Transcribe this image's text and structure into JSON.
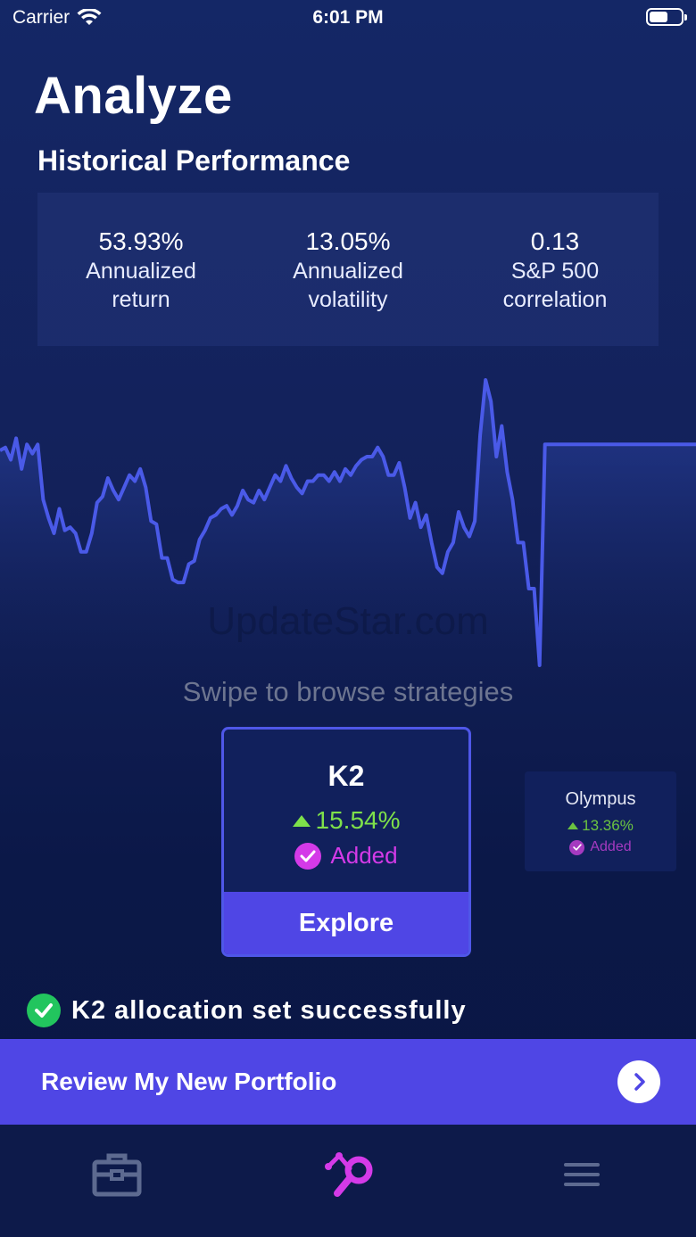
{
  "status_bar": {
    "carrier": "Carrier",
    "time": "6:01 PM"
  },
  "header": {
    "title": "Analyze",
    "section_title": "Historical Performance"
  },
  "stats": [
    {
      "value": "53.93%",
      "label": "Annualized return"
    },
    {
      "value": "13.05%",
      "label": "Annualized volatility"
    },
    {
      "value": "0.13",
      "label": "S&P 500 correlation"
    }
  ],
  "chart_data": {
    "type": "area",
    "title": "",
    "xlabel": "",
    "ylabel": "",
    "grid": false,
    "line_color": "#4a5ae8",
    "x": [
      0,
      1,
      2,
      3,
      4,
      5,
      6,
      7,
      8,
      9,
      10,
      11,
      12,
      13,
      14,
      15,
      16,
      17,
      18,
      19,
      20,
      21,
      22,
      23,
      24,
      25,
      26,
      27,
      28,
      29,
      30,
      31,
      32,
      33,
      34,
      35,
      36,
      37,
      38,
      39,
      40,
      41,
      42,
      43,
      44,
      45,
      46,
      47,
      48,
      49,
      50,
      51,
      52,
      53,
      54,
      55,
      56,
      57,
      58,
      59,
      60,
      61,
      62,
      63,
      64,
      65,
      66,
      67,
      68,
      69,
      70,
      71,
      72,
      73,
      74,
      75,
      76,
      77,
      78,
      79,
      80,
      81,
      82,
      83,
      84,
      85,
      86,
      87,
      88,
      89,
      90,
      91,
      92,
      93,
      94,
      95,
      96,
      97,
      98,
      99,
      100,
      101,
      102,
      103,
      104,
      105,
      106,
      107,
      108,
      109,
      110,
      111,
      112,
      113,
      114,
      115,
      116,
      117,
      118,
      119,
      120,
      121,
      122,
      123,
      124,
      125,
      126,
      127,
      128,
      129
    ],
    "values": [
      70,
      71,
      67,
      74,
      64,
      72,
      69,
      72,
      54,
      48,
      43,
      51,
      44,
      45,
      43,
      37,
      37,
      43,
      53,
      55,
      61,
      57,
      54,
      58,
      62,
      60,
      64,
      58,
      47,
      46,
      35,
      35,
      28,
      27,
      27,
      33,
      34,
      41,
      44,
      48,
      49,
      51,
      52,
      49,
      52,
      57,
      54,
      53,
      57,
      54,
      58,
      62,
      60,
      65,
      61,
      58,
      56,
      60,
      60,
      62,
      62,
      60,
      63,
      60,
      64,
      62,
      65,
      67,
      68,
      68,
      71,
      68,
      62,
      62,
      66,
      58,
      48,
      53,
      45,
      49,
      40,
      32,
      30,
      37,
      40,
      50,
      45,
      42,
      47,
      75,
      93,
      86,
      68,
      78,
      63,
      54,
      40,
      40,
      25,
      25,
      0,
      72,
      72,
      72,
      72,
      72,
      72,
      72,
      72,
      72,
      72,
      72,
      72,
      72,
      72,
      72,
      72,
      72,
      72,
      72,
      72,
      72,
      72,
      72,
      72,
      72,
      72,
      72,
      72,
      72
    ]
  },
  "watermark": "UpdateStar.com",
  "swipe_hint": "Swipe to browse strategies",
  "strategy_main": {
    "name": "K2",
    "return": "15.54%",
    "status": "Added",
    "button": "Explore"
  },
  "strategy_secondary": {
    "name": "Olympus",
    "return": "13.36%",
    "status": "Added"
  },
  "success_message": "K2 allocation set successfully",
  "review_button": {
    "label": "Review My New Portfolio"
  },
  "tab_bar": {
    "icons": [
      "briefcase-icon",
      "analyze-icon",
      "menu-icon"
    ],
    "active_color": "#d43ae8",
    "inactive_color": "#5d6a90"
  }
}
